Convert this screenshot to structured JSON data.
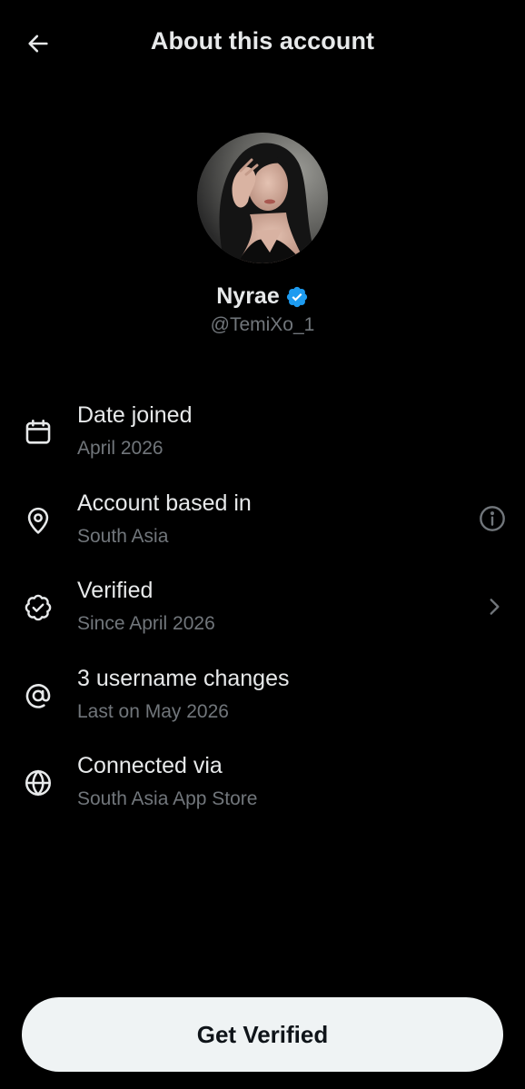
{
  "header": {
    "title": "About this account",
    "back_icon": "arrow-left-icon"
  },
  "profile": {
    "display_name": "Nyrae",
    "handle": "@TemiXo_1",
    "verified": true,
    "badge_color": "#1d9bf0"
  },
  "info_rows": [
    {
      "icon": "calendar-icon",
      "title": "Date joined",
      "subtitle": "April 2026",
      "trailing": null
    },
    {
      "icon": "location-pin-icon",
      "title": "Account based in",
      "subtitle": "South Asia",
      "trailing": "info-icon"
    },
    {
      "icon": "verified-seal-icon",
      "title": "Verified",
      "subtitle": "Since April 2026",
      "trailing": "chevron-right-icon"
    },
    {
      "icon": "at-sign-icon",
      "title": "3 username changes",
      "subtitle": "Last on May 2026",
      "trailing": null
    },
    {
      "icon": "globe-icon",
      "title": "Connected via",
      "subtitle": "South Asia App Store",
      "trailing": null
    }
  ],
  "cta": {
    "label": "Get Verified"
  },
  "colors": {
    "background": "#000000",
    "primary_text": "#e7e9ea",
    "secondary_text": "#71767b",
    "button_bg": "#eff3f4",
    "button_text": "#0f1419"
  }
}
